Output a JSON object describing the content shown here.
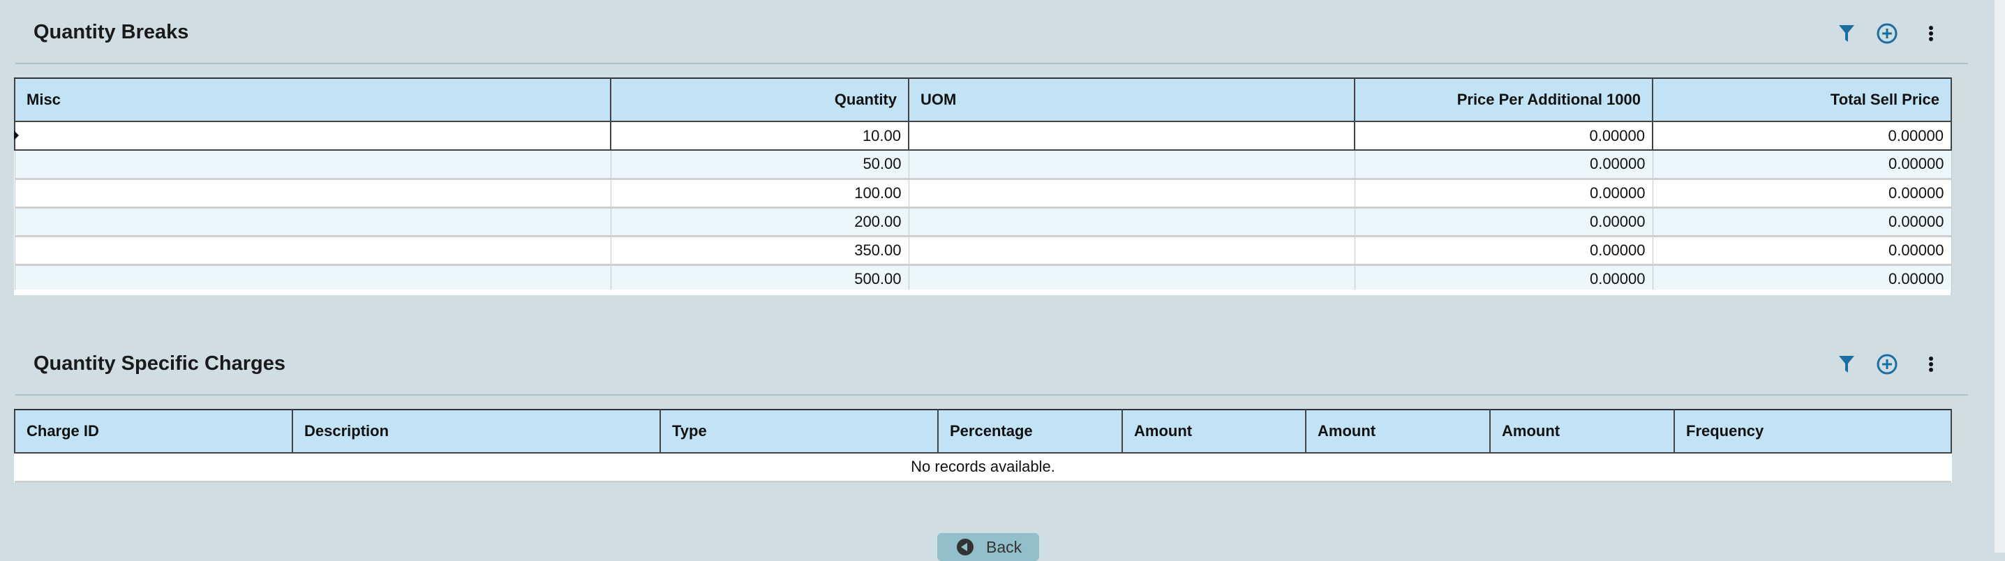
{
  "quantity_breaks": {
    "title": "Quantity Breaks",
    "columns": [
      "Misc",
      "Quantity",
      "UOM",
      "Price Per Additional 1000",
      "Total Sell Price"
    ],
    "rows": [
      {
        "misc": "",
        "quantity": "10.00",
        "uom": "",
        "price_per_1000": "0.00000",
        "total_sell_price": "0.00000"
      },
      {
        "misc": "",
        "quantity": "50.00",
        "uom": "",
        "price_per_1000": "0.00000",
        "total_sell_price": "0.00000"
      },
      {
        "misc": "",
        "quantity": "100.00",
        "uom": "",
        "price_per_1000": "0.00000",
        "total_sell_price": "0.00000"
      },
      {
        "misc": "",
        "quantity": "200.00",
        "uom": "",
        "price_per_1000": "0.00000",
        "total_sell_price": "0.00000"
      },
      {
        "misc": "",
        "quantity": "350.00",
        "uom": "",
        "price_per_1000": "0.00000",
        "total_sell_price": "0.00000"
      },
      {
        "misc": "",
        "quantity": "500.00",
        "uom": "",
        "price_per_1000": "0.00000",
        "total_sell_price": "0.00000"
      }
    ]
  },
  "quantity_specific_charges": {
    "title": "Quantity Specific Charges",
    "columns": [
      "Charge ID",
      "Description",
      "Type",
      "Percentage",
      "Amount",
      "Amount",
      "Amount",
      "Frequency"
    ],
    "empty_message": "No records available."
  },
  "back_label": "Back",
  "colors": {
    "accent": "#1a6fa0",
    "header_bg": "#c1e3f5",
    "page_bg": "#d0dee3"
  }
}
